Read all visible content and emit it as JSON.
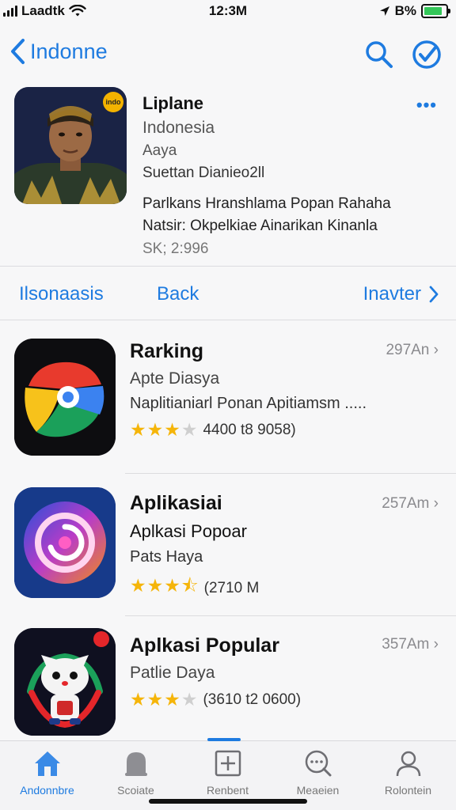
{
  "status": {
    "carrier": "Laadtk",
    "time": "12:3M",
    "battery": "B%",
    "battery_level": 0.85,
    "battery_color": "#34c759"
  },
  "nav": {
    "back_label": "Indonne",
    "icons": [
      "search-icon",
      "check-circle-icon"
    ],
    "accent": "#1e7be0"
  },
  "hero": {
    "title": "Liplane",
    "subtitle": "Indonesia",
    "line1": "Aaya",
    "line2": "Suettan Dianieo2ll",
    "description_1": "Parlkans Hranshlama Popan Rahaha",
    "description_2": "Natsir: Okpelkiae Ainarikan Kinanla",
    "count": "SK; 2:996",
    "badge": "indo",
    "more": "•••"
  },
  "segments": {
    "left": "Ilsonaasis",
    "middle": "Back",
    "right": "Inavter"
  },
  "apps": [
    {
      "name": "Rarking",
      "sub": "Apte Diasya",
      "desc": "Naplitianiarl Ponan Apitiamsm .....",
      "rating_value": 3,
      "rating_text": "4400 t8 9058)",
      "size": "297An"
    },
    {
      "name": "Aplikasiai",
      "sub": "Aplkasi Popoar",
      "desc": "Pats Haya",
      "rating_value": 3.5,
      "rating_text": "(2710 M",
      "size": "257Am"
    },
    {
      "name": "Aplkasi Popular",
      "sub": "Patlie Daya",
      "desc": "",
      "rating_value": 3,
      "rating_text": "(3610 t2 0600)",
      "size": "357Am"
    }
  ],
  "tabs": [
    {
      "label": "Andonnbre",
      "icon": "home-icon",
      "active": true
    },
    {
      "label": "Scoiate",
      "icon": "bell-icon",
      "active": false
    },
    {
      "label": "Renbent",
      "icon": "plus-square-icon",
      "active": false
    },
    {
      "label": "Meaeien",
      "icon": "chat-search-icon",
      "active": false
    },
    {
      "label": "Rolontein",
      "icon": "person-icon",
      "active": false
    }
  ]
}
